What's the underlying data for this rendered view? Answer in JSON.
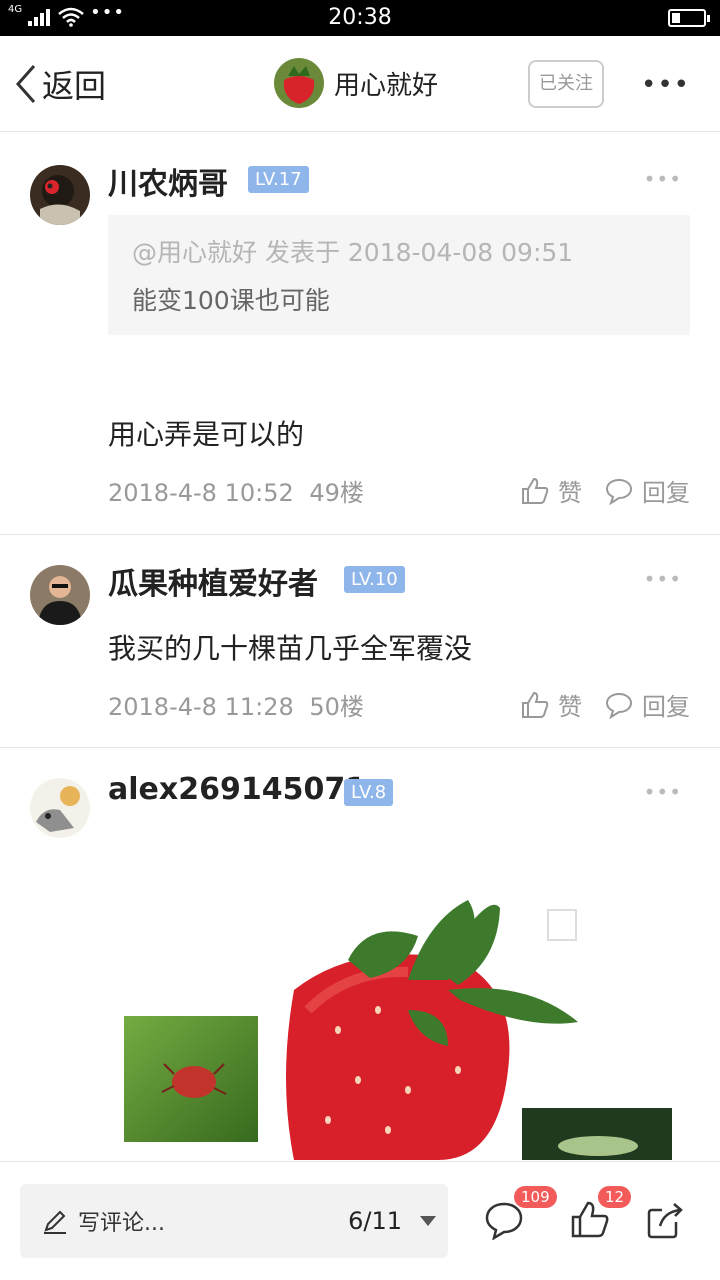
{
  "status": {
    "network": "4G",
    "time": "20:38"
  },
  "header": {
    "back_label": "返回",
    "author": "用心就好",
    "follow": "已关注"
  },
  "posts": [
    {
      "username": "川农炳哥",
      "level": "LV.17",
      "quote_meta": "@用心就好 发表于 2018-04-08 09:51",
      "quote_text": "能变100课也可能",
      "content": "用心弄是可以的",
      "time": "2018-4-8 10:52",
      "floor": "49楼",
      "like_label": "赞",
      "reply_label": "回复"
    },
    {
      "username": "瓜果种植爱好者",
      "level": "LV.10",
      "content": "我买的几十棵苗几乎全军覆没",
      "time": "2018-4-8 11:28",
      "floor": "50楼",
      "like_label": "赞",
      "reply_label": "回复"
    },
    {
      "username": "alex269145071",
      "level": "LV.8"
    }
  ],
  "bottom": {
    "comment_placeholder": "写评论...",
    "page": "6/11",
    "comment_count": "109",
    "like_count": "12"
  },
  "colors": {
    "level_badge": "#8fb6ea",
    "badge": "#f35a5a"
  }
}
